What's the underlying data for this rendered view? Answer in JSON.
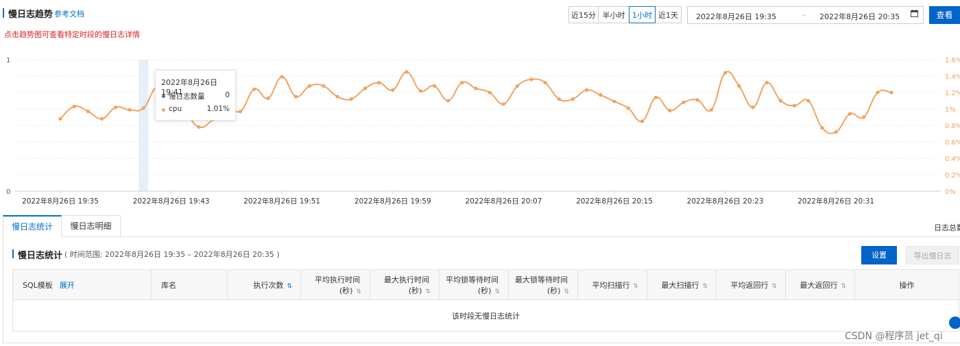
{
  "header": {
    "title": "慢日志趋势",
    "doc_link": "参考文档",
    "hint": "点击趋势图可查看特定时段的慢日志详情"
  },
  "time_buttons": [
    {
      "label": "近15分",
      "active": false
    },
    {
      "label": "半小时",
      "active": false
    },
    {
      "label": "1小时",
      "active": true
    },
    {
      "label": "近1天",
      "active": false
    }
  ],
  "date_range": {
    "start": "2022年8月26日 19:35",
    "separator": "–",
    "end": "2022年8月26日 20:35"
  },
  "query_button": "查看",
  "tooltip": {
    "time": "2022年8月26日 19:41",
    "rows": [
      {
        "name": "慢日志数量",
        "value": "0",
        "color": "#3d6fb0"
      },
      {
        "name": "cpu",
        "value": "1.01%",
        "color": "#f0a35e"
      }
    ]
  },
  "chart_data": {
    "type": "line",
    "x_ticks": [
      "2022年8月26日 19:35",
      "2022年8月26日 19:43",
      "2022年8月26日 19:51",
      "2022年8月26日 19:59",
      "2022年8月26日 20:07",
      "2022年8月26日 20:15",
      "2022年8月26日 20:23",
      "2022年8月26日 20:31"
    ],
    "y_left_ticks": [
      "0",
      "1"
    ],
    "y_right_ticks": [
      "0%",
      "0.2%",
      "0.4%",
      "0.6%",
      "0.8%",
      "1%",
      "1.2%",
      "1.4%",
      "1.6%"
    ],
    "ylim_left": [
      0,
      1
    ],
    "ylim_right": [
      0,
      1.6
    ],
    "series": [
      {
        "name": "慢日志数量",
        "color": "#3d6fb0",
        "minutes": [],
        "values": []
      },
      {
        "name": "cpu",
        "color": "#f0a35e",
        "minutes": [
          35,
          36,
          37,
          38,
          39,
          40,
          41,
          42,
          43,
          44,
          45,
          46,
          47,
          48,
          49,
          50,
          51,
          52,
          53,
          54,
          55,
          56,
          57,
          58,
          59,
          60,
          61,
          62,
          63,
          64,
          65,
          66,
          67,
          68,
          69,
          70,
          71,
          72,
          73,
          74,
          75,
          76,
          77,
          78,
          79,
          80,
          81,
          82,
          83,
          84,
          85,
          86,
          87,
          88,
          89,
          90,
          91,
          92,
          93,
          94,
          95
        ],
        "values": [
          0.88,
          1.03,
          0.97,
          0.88,
          1.02,
          0.99,
          1.01,
          1.28,
          1.2,
          0.98,
          0.78,
          0.87,
          1.04,
          0.97,
          1.24,
          1.13,
          1.39,
          1.15,
          1.28,
          1.28,
          1.15,
          1.12,
          1.25,
          1.32,
          1.23,
          1.45,
          1.22,
          1.28,
          1.1,
          1.32,
          1.25,
          1.2,
          1.06,
          1.28,
          1.36,
          1.32,
          1.12,
          1.12,
          1.23,
          1.17,
          1.09,
          1.01,
          0.85,
          1.14,
          0.98,
          1.08,
          1.11,
          0.99,
          1.44,
          1.28,
          1.02,
          1.32,
          1.1,
          1.04,
          1.1,
          0.77,
          0.72,
          0.94,
          0.9,
          1.2,
          1.2
        ]
      }
    ],
    "highlight_minute": 41,
    "grid": true
  },
  "tabs": [
    {
      "label": "慢日志统计",
      "active": true
    },
    {
      "label": "慢日志明细",
      "active": false
    }
  ],
  "tabs_right_text": "日志总数",
  "stats": {
    "title": "慢日志统计",
    "range_text": "( 时间范围: 2022年8月26日 19:35 – 2022年8月26日 20:35 )",
    "settings_button": "设置",
    "export_button": "导出慢日志",
    "columns": [
      "SQL模板",
      "库名",
      "执行次数",
      "平均执行时间\n(秒)",
      "最大执行时间\n(秒)",
      "平均锁等待时间\n(秒)",
      "最大锁等待时间\n(秒)",
      "平均扫描行",
      "最大扫描行",
      "平均返回行",
      "最大返回行",
      "操作"
    ],
    "expand_link": "展开",
    "empty_text": "该时段无慢日志统计"
  },
  "watermark": "CSDN @程序员 jet_qi"
}
